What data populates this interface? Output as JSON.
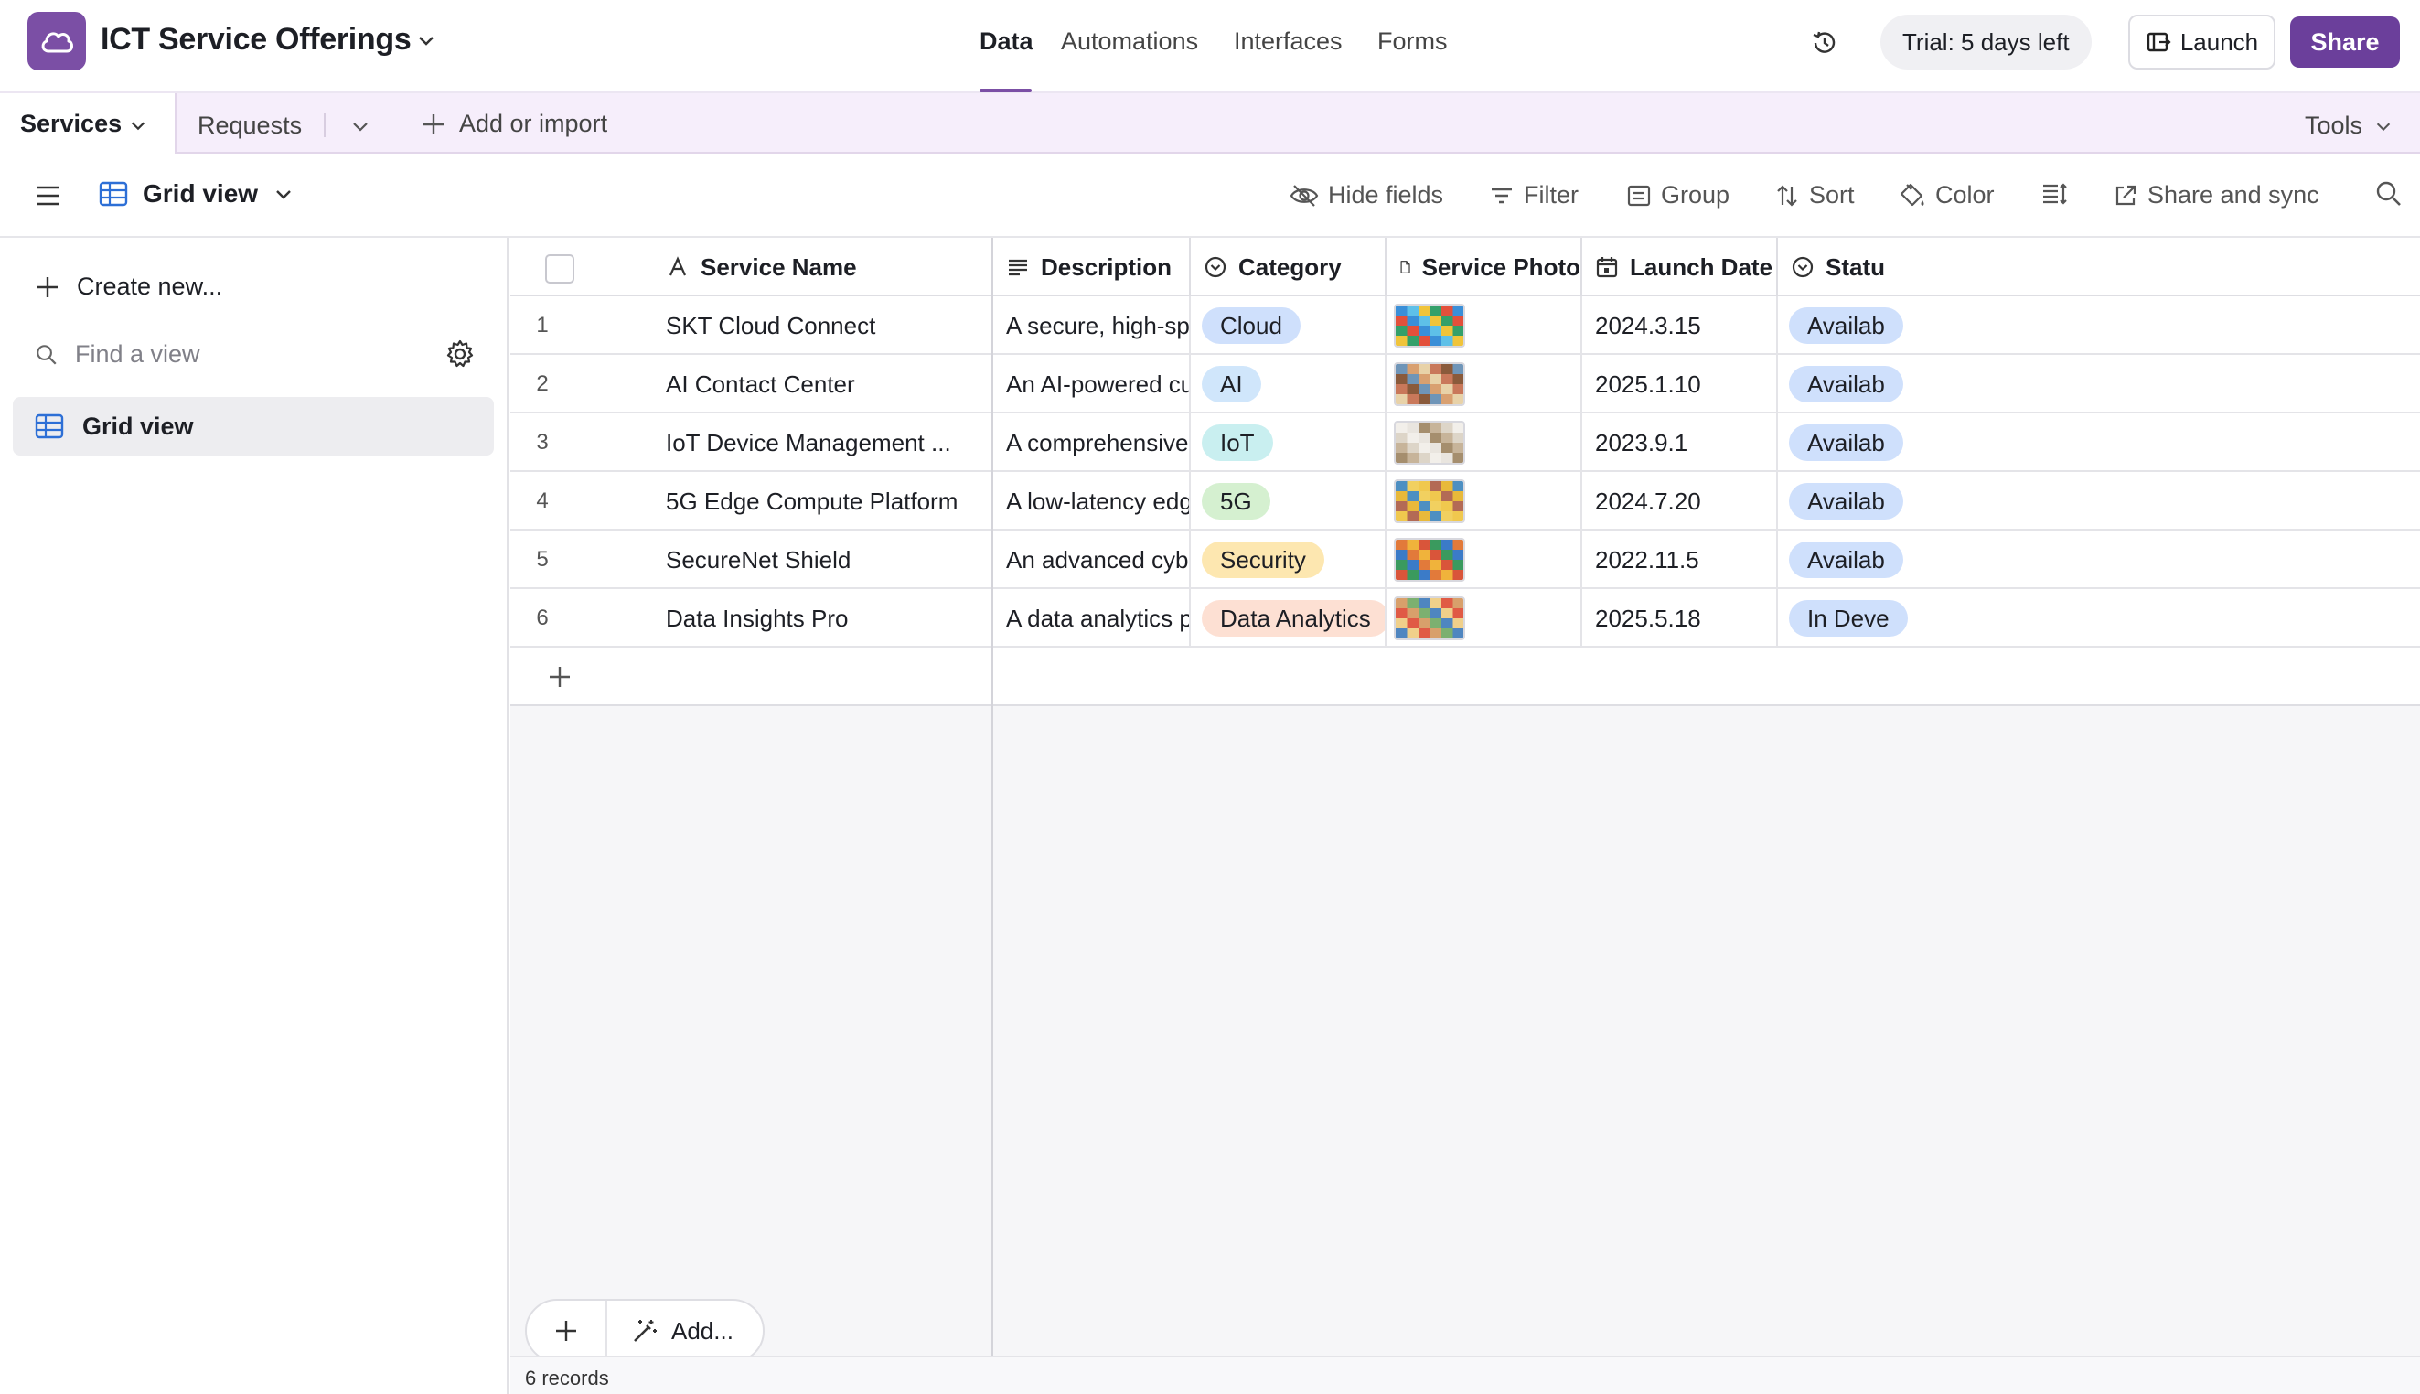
{
  "app": {
    "base_title": "ICT Service Offerings",
    "nav": [
      "Data",
      "Automations",
      "Interfaces",
      "Forms"
    ],
    "trial": "Trial: 5 days left",
    "launch": "Launch",
    "share": "Share",
    "accent": "#7b4fa5"
  },
  "tabs": {
    "active": "Services",
    "other": "Requests",
    "add_or_import": "Add or import",
    "tools": "Tools"
  },
  "toolbar": {
    "view_name": "Grid view",
    "hide_fields": "Hide fields",
    "filter": "Filter",
    "group": "Group",
    "sort": "Sort",
    "color": "Color",
    "share_sync": "Share and sync"
  },
  "sidebar": {
    "create_new": "Create new...",
    "find_placeholder": "Find a view",
    "views": [
      "Grid view"
    ]
  },
  "grid": {
    "columns": [
      "Service Name",
      "Description",
      "Category",
      "Service Photo",
      "Launch Date",
      "Statu"
    ],
    "rows": [
      {
        "num": "1",
        "name": "SKT Cloud Connect",
        "desc": "A secure, high-speed clo...",
        "category": "Cloud",
        "cat_color": "#cfe0fc",
        "date": "2024.3.15",
        "status": "Availab",
        "photo": "photo-1"
      },
      {
        "num": "2",
        "name": "AI Contact Center",
        "desc": "An AI-powered customer ...",
        "category": "AI",
        "cat_color": "#d0e6fb",
        "date": "2025.1.10",
        "status": "Availab",
        "photo": "photo-2"
      },
      {
        "num": "3",
        "name": "IoT Device Management ...",
        "desc": "A comprehensive platfor...",
        "category": "IoT",
        "cat_color": "#c9eff0",
        "date": "2023.9.1",
        "status": "Availab",
        "photo": "photo-3"
      },
      {
        "num": "4",
        "name": "5G Edge Compute Platform",
        "desc": "A low-latency edge comp...",
        "category": "5G",
        "cat_color": "#d5f0d0",
        "date": "2024.7.20",
        "status": "Availab",
        "photo": "photo-4"
      },
      {
        "num": "5",
        "name": "SecureNet Shield",
        "desc": "An advanced cybersecuri...",
        "category": "Security",
        "cat_color": "#fde7b0",
        "date": "2022.11.5",
        "status": "Availab",
        "photo": "photo-5"
      },
      {
        "num": "6",
        "name": "Data Insights Pro",
        "desc": "A data analytics platform ...",
        "category": "Data Analytics",
        "cat_color": "#fde0d3",
        "date": "2025.5.18",
        "status": "In Deve",
        "photo": "photo-6"
      }
    ],
    "status_color": "#cfe0fc",
    "add_label": "Add...",
    "record_count": "6 records"
  }
}
